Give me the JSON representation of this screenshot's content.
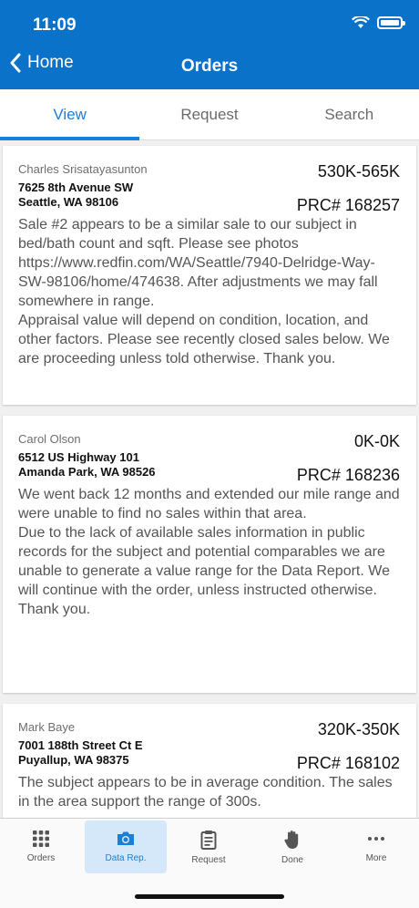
{
  "status": {
    "time": "11:09"
  },
  "nav": {
    "back_label": "Home",
    "title": "Orders"
  },
  "tabs": [
    {
      "label": "View",
      "active": true
    },
    {
      "label": "Request",
      "active": false
    },
    {
      "label": "Search",
      "active": false
    }
  ],
  "orders": [
    {
      "name": "Charles Srisatayasunton",
      "range": "530K-565K",
      "address_line1": "7625 8th Avenue SW",
      "address_line2": "Seattle, WA 98106",
      "prc": "PRC# 168257",
      "note": "Sale #2 appears to be a similar sale to our subject in bed/bath count and sqft. Please see photos https://www.redfin.com/WA/Seattle/7940-Delridge-Way-SW-98106/home/474638. After adjustments we may fall somewhere in range.\nAppraisal value will depend on condition, location, and other factors. Please see recently closed sales below. We are proceeding unless told otherwise. Thank you."
    },
    {
      "name": "Carol Olson",
      "range": "0K-0K",
      "address_line1": "6512 US Highway 101",
      "address_line2": "Amanda Park, WA 98526",
      "prc": "PRC# 168236",
      "note": "We went back 12 months and extended our mile range and were unable to find no sales within that area.\nDue to the lack of available sales information in public records for the subject and potential comparables we are unable to generate a value range for the Data Report.  We will continue with the order, unless instructed otherwise. Thank you."
    },
    {
      "name": "Mark Baye",
      "range": "320K-350K",
      "address_line1": "7001 188th Street Ct E",
      "address_line2": "Puyallup, WA 98375",
      "prc": "PRC# 168102",
      "note": "The subject appears to be in average condition. The sales in the area support the range of 300s."
    }
  ],
  "tabbar": [
    {
      "label": "Orders",
      "icon": "grid-icon",
      "active": false
    },
    {
      "label": "Data Rep.",
      "icon": "camera-icon",
      "active": true
    },
    {
      "label": "Request",
      "icon": "clipboard-icon",
      "active": false
    },
    {
      "label": "Done",
      "icon": "hand-icon",
      "active": false
    },
    {
      "label": "More",
      "icon": "more-icon",
      "active": false
    }
  ],
  "colors": {
    "header": "#0a72c9",
    "accent": "#1a7fd8",
    "active_tab_bg": "#d4e8fa"
  }
}
